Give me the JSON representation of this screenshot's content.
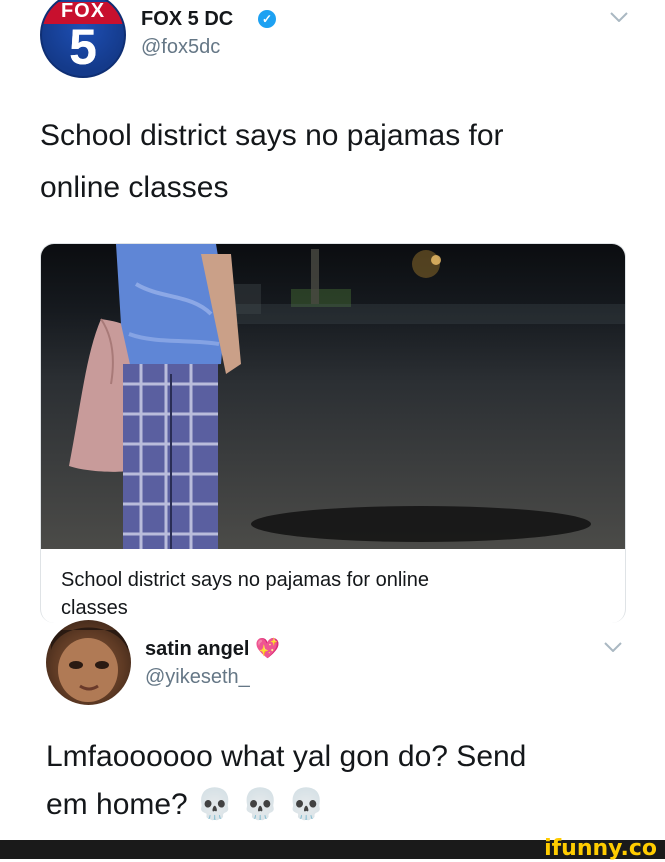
{
  "tweet1": {
    "avatar_text_top": "FOX",
    "avatar_text_number": "5",
    "display_name": "FOX 5 DC",
    "handle": "@fox5dc",
    "text_line1": "School district says no pajamas for",
    "text_line2": "online classes",
    "card": {
      "title_line1": "School district says no pajamas for online",
      "title_line2": "classes"
    },
    "icons": [
      "verified-badge-icon",
      "chevron-down-icon"
    ]
  },
  "tweet2": {
    "display_name": "satin angel",
    "name_emoji": "💖",
    "handle": "@yikeseth_",
    "text_line1": "Lmfaoooooo what yal gon do? Send",
    "text_line2": "em home? 💀 💀 💀",
    "icons": [
      "chevron-down-icon"
    ]
  },
  "watermark": "ifunny.co",
  "colors": {
    "verified": "#1da1f2",
    "handle": "#657786",
    "fox_red": "#c8102e",
    "fox_blue": "#143a8a",
    "watermark": "#ffcc00"
  }
}
